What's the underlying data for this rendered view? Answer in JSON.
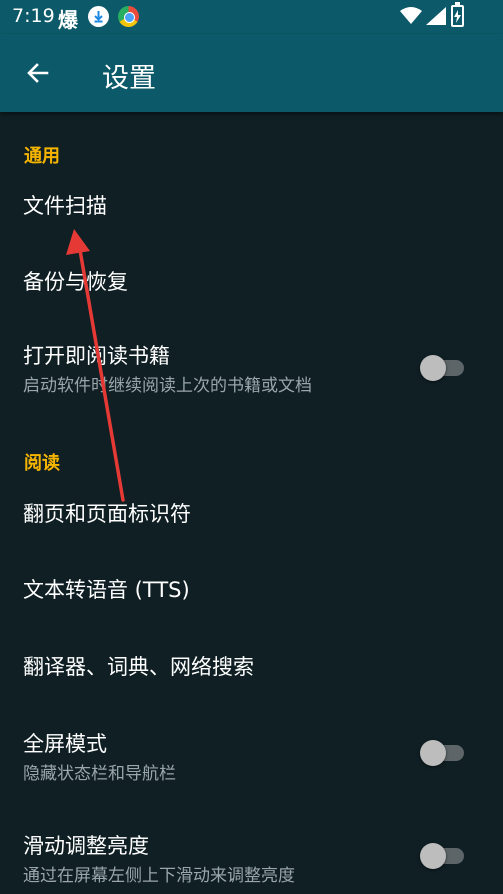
{
  "status_bar": {
    "time": "7:19",
    "app_glyph": "爆"
  },
  "header": {
    "title": "设置",
    "back_icon": "arrow-left-icon"
  },
  "sections": [
    {
      "header": "通用"
    },
    {
      "header": "阅读"
    }
  ],
  "items": {
    "file_scan": {
      "title": "文件扫描"
    },
    "backup_restore": {
      "title": "备份与恢复"
    },
    "open_on_start": {
      "title": "打开即阅读书籍",
      "subtitle": "启动软件时继续阅读上次的书籍或文档",
      "enabled": false
    },
    "page_turn": {
      "title": "翻页和页面标识符"
    },
    "tts": {
      "title": "文本转语音 (TTS)"
    },
    "translator": {
      "title": "翻译器、词典、网络搜索"
    },
    "fullscreen": {
      "title": "全屏模式",
      "subtitle": "隐藏状态栏和导航栏",
      "enabled": false
    },
    "brightness": {
      "title": "滑动调整亮度",
      "subtitle": "通过在屏幕左侧上下滑动来调整亮度",
      "enabled": false
    }
  },
  "colors": {
    "app_bar": "#0c5a69",
    "background": "#0f1f24",
    "accent": "#f5b400",
    "annotation_arrow": "#e53935"
  }
}
